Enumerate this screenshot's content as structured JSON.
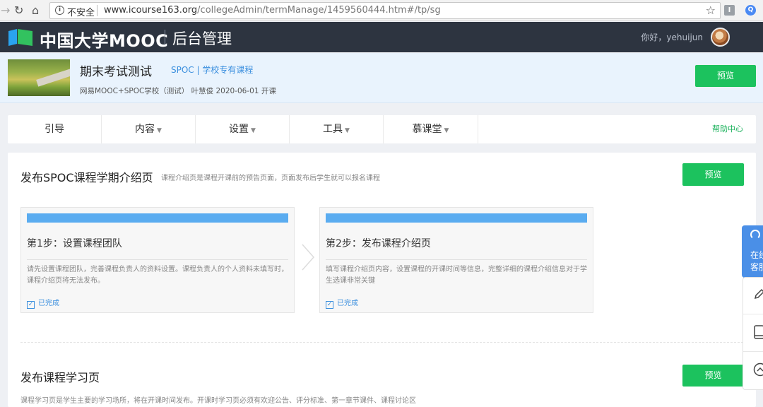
{
  "browser": {
    "security_label": "不安全",
    "url_host": "www.icourse163.org",
    "url_path": "/collegeAdmin/termManage/1459560444.htm#/tp/sg"
  },
  "header": {
    "logo_text": "中国大学MOOC",
    "admin_title": "后台管理",
    "greeting": "你好，yehuijun"
  },
  "course": {
    "title": "期末考试测试",
    "tag": "SPOC | 学校专有课程",
    "meta": "网易MOOC+SPOC学校（测试）  叶慧俊    2020-06-01 开课",
    "preview_label": "预览"
  },
  "tabs": [
    {
      "label": "引导",
      "has_dropdown": false
    },
    {
      "label": "内容",
      "has_dropdown": true
    },
    {
      "label": "设置",
      "has_dropdown": true
    },
    {
      "label": "工具",
      "has_dropdown": true
    },
    {
      "label": "慕课堂",
      "has_dropdown": true
    }
  ],
  "help_label": "帮助中心",
  "section1": {
    "title": "发布SPOC课程学期介绍页",
    "desc": "课程介绍页是课程开课前的预告页面，页面发布后学生就可以报名课程",
    "preview_label": "预览",
    "steps": [
      {
        "title": "第1步：设置课程团队",
        "desc": "请先设置课程团队，完善课程负责人的资料设置。课程负责人的个人资料未填写时，课程介绍页将无法发布。",
        "status": "已完成"
      },
      {
        "title": "第2步：发布课程介绍页",
        "desc": "填写课程介绍页内容，设置课程的开课时间等信息，完整详细的课程介绍信息对于学生选课非常关键",
        "status": "已完成"
      }
    ]
  },
  "section2": {
    "title": "发布课程学习页",
    "desc": "课程学习页是学生主要的学习场所，将在开课时间发布。开课时学习页必须有欢迎公告、评分标准、第一章节课件、课程讨论区",
    "preview_label": "预览"
  },
  "float_service": {
    "label_line1": "在线",
    "label_line2": "客服"
  },
  "colors": {
    "header_bg": "#2d3440",
    "course_bar_bg": "#e9f3fd",
    "accent_green": "#1cc25e",
    "accent_blue": "#3b8fde",
    "step_bar": "#5aacf0"
  }
}
